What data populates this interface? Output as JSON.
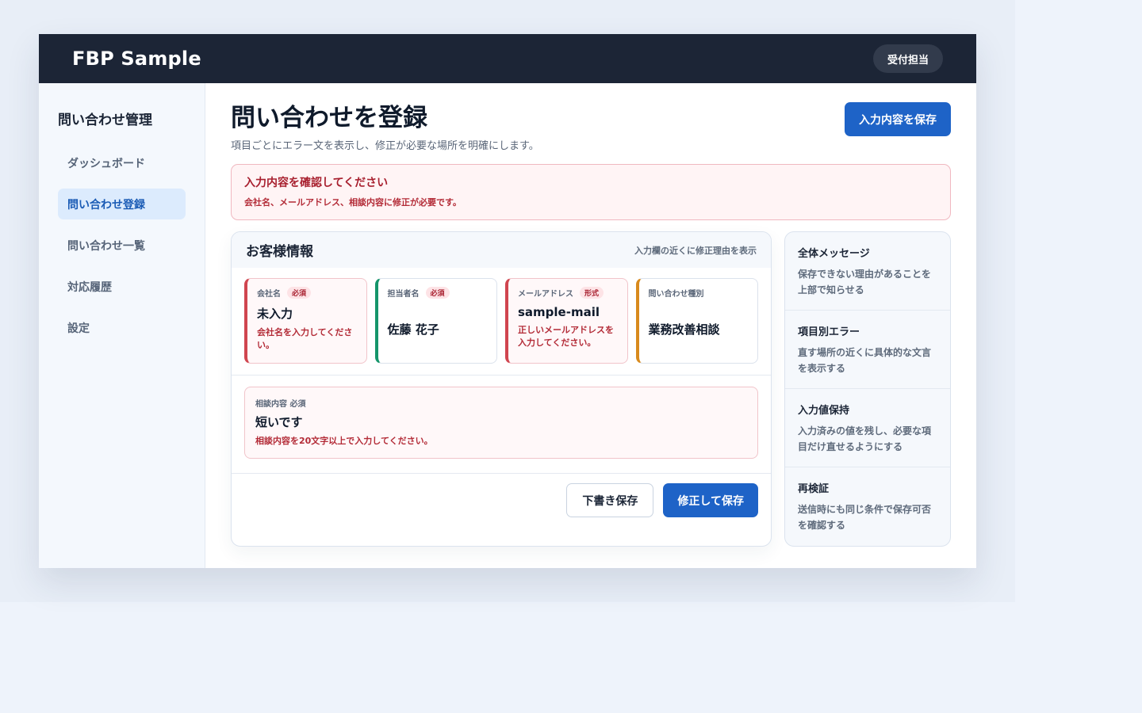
{
  "header": {
    "brand": "FBP Sample",
    "role": "受付担当"
  },
  "sidebar": {
    "title": "問い合わせ管理",
    "items": [
      {
        "label": "ダッシュボード",
        "active": false
      },
      {
        "label": "問い合わせ登録",
        "active": true
      },
      {
        "label": "問い合わせ一覧",
        "active": false
      },
      {
        "label": "対応履歴",
        "active": false
      },
      {
        "label": "設定",
        "active": false
      }
    ]
  },
  "page": {
    "title": "問い合わせを登録",
    "subtitle": "項目ごとにエラー文を表示し、修正が必要な場所を明確にします。",
    "save_label": "入力内容を保存"
  },
  "alert": {
    "title": "入力内容を確認してください",
    "message": "会社名、メールアドレス、相談内容に修正が必要です。"
  },
  "form": {
    "title": "お客様情報",
    "hint": "入力欄の近くに修正理由を表示",
    "fields": [
      {
        "label": "会社名",
        "tag": "必須",
        "value": "未入力",
        "error": "会社名を入力してください。"
      },
      {
        "label": "担当者名",
        "tag": "必須",
        "value": "佐藤 花子",
        "error": ""
      },
      {
        "label": "メールアドレス",
        "tag": "形式",
        "value": "sample-mail",
        "error": "正しいメールアドレスを入力してください。"
      },
      {
        "label": "問い合わせ種別",
        "tag": "",
        "value": "業務改善相談",
        "error": ""
      }
    ],
    "consultation": {
      "label": "相談内容 必須",
      "value": "短いです",
      "error": "相談内容を20文字以上で入力してください。"
    },
    "draft_label": "下書き保存",
    "submit_label": "修正して保存"
  },
  "tips": [
    {
      "title": "全体メッセージ",
      "text": "保存できない理由があることを上部で知らせる"
    },
    {
      "title": "項目別エラー",
      "text": "直す場所の近くに具体的な文言を表示する"
    },
    {
      "title": "入力値保持",
      "text": "入力済みの値を残し、必要な項目だけ直せるようにする"
    },
    {
      "title": "再検証",
      "text": "送信時にも同じ条件で保存可否を確認する"
    }
  ],
  "colors": {
    "topbar": "#1c2536",
    "primary": "#1e63c7",
    "error": "#d0454f",
    "ok_green": "#14956a",
    "ok_amber": "#d88a1c"
  }
}
